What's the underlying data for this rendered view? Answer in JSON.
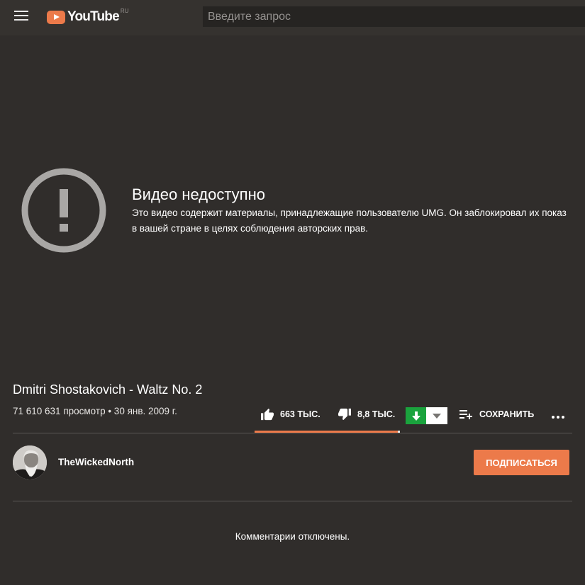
{
  "header": {
    "logo_text": "YouTube",
    "logo_country": "RU",
    "search_placeholder": "Введите запрос"
  },
  "player": {
    "error_title": "Видео недоступно",
    "error_message": "Это видео содержит материалы, принадлежащие пользователю UMG. Он заблокировал их показ в вашей стране в целях соблюдения авторских прав."
  },
  "video": {
    "title": "Dmitri Shostakovich - Waltz No. 2",
    "meta": "71 610 631 просмотр • 30 янв. 2009 г."
  },
  "actions": {
    "likes": "663 ТЫС.",
    "dislikes": "8,8 ТЫС.",
    "save": "СОХРАНИТЬ",
    "like_ratio": 0.987
  },
  "channel": {
    "name": "TheWickedNorth",
    "subscribe_label": "ПОДПИСАТЬСЯ"
  },
  "comments": {
    "status": "Комментарии отключены."
  },
  "colors": {
    "accent": "#ec7a4a",
    "download_green": "#1aa33d",
    "background": "#302d2b"
  }
}
